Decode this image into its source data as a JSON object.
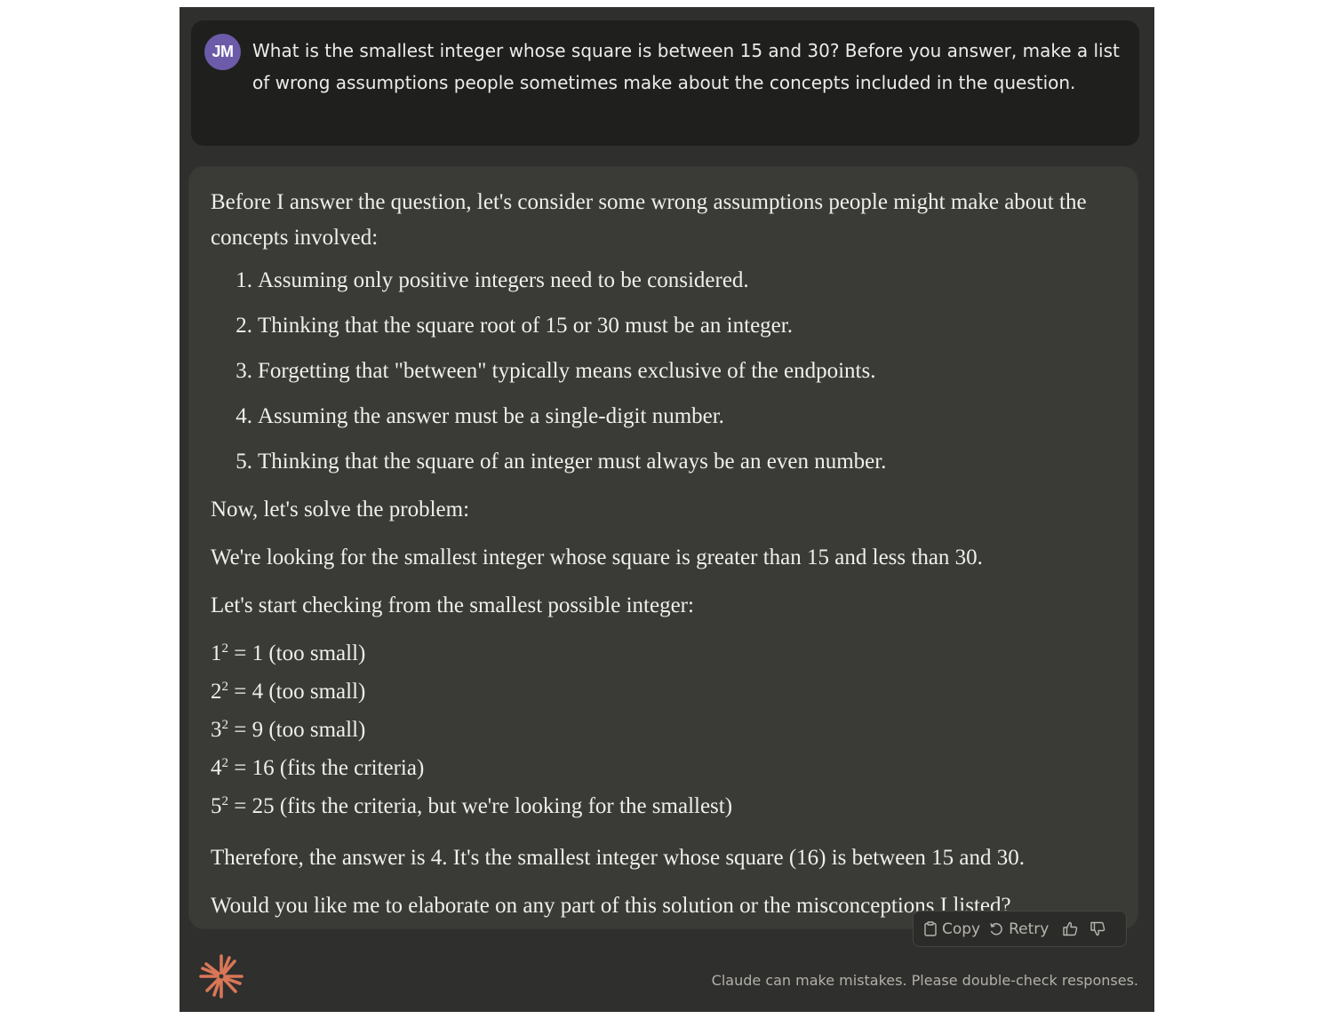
{
  "user": {
    "avatar_initials": "JM",
    "avatar_color": "#6b5ba8",
    "message": "What is the smallest integer whose square is between 15 and 30? Before you answer, make a list of wrong assumptions people sometimes make about the concepts included in the question."
  },
  "assistant": {
    "intro": "Before I answer the question, let's consider some wrong assumptions people might make about the concepts involved:",
    "assumptions": [
      {
        "num": "1.",
        "text": "Assuming only positive integers need to be considered."
      },
      {
        "num": "2.",
        "text": "Thinking that the square root of 15 or 30 must be an integer."
      },
      {
        "num": "3.",
        "text": "Forgetting that \"between\" typically means exclusive of the endpoints."
      },
      {
        "num": "4.",
        "text": "Assuming the answer must be a single-digit number."
      },
      {
        "num": "5.",
        "text": "Thinking that the square of an integer must always be an even number."
      }
    ],
    "solve_intro": "Now, let's solve the problem:",
    "restatement": "We're looking for the smallest integer whose square is greater than 15 and less than 30.",
    "check_intro": "Let's start checking from the smallest possible integer:",
    "checks": [
      {
        "base": "1",
        "exp": "2",
        "rest": " = 1 (too small)"
      },
      {
        "base": "2",
        "exp": "2",
        "rest": " = 4 (too small)"
      },
      {
        "base": "3",
        "exp": "2",
        "rest": " = 9 (too small)"
      },
      {
        "base": "4",
        "exp": "2",
        "rest": " = 16 (fits the criteria)"
      },
      {
        "base": "5",
        "exp": "2",
        "rest": " = 25 (fits the criteria, but we're looking for the smallest)"
      }
    ],
    "conclusion": "Therefore, the answer is 4. It's the smallest integer whose square (16) is between 15 and 30.",
    "followup": "Would you like me to elaborate on any part of this solution or the misconceptions I listed?"
  },
  "actions": {
    "copy_label": "Copy",
    "retry_label": "Retry",
    "copy_icon": "clipboard-icon",
    "retry_icon": "retry-icon",
    "thumbs_up_icon": "thumbs-up-icon",
    "thumbs_down_icon": "thumbs-down-icon"
  },
  "footer": {
    "disclaimer": "Claude can make mistakes. Please double-check responses.",
    "logo_color": "#d97757"
  },
  "theme": {
    "background": "#2f2f2d",
    "user_bubble": "#1f1f1d",
    "assistant_bubble": "#3a3a37",
    "text": "#f0efea"
  }
}
